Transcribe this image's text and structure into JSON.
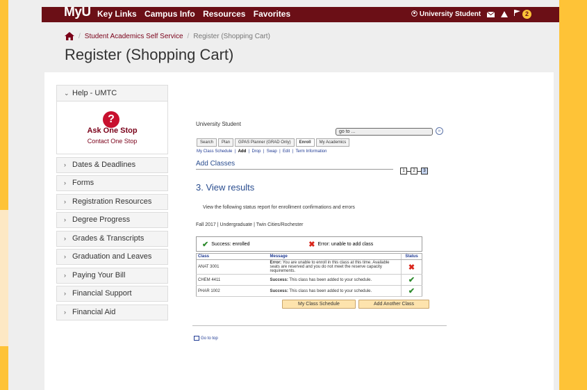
{
  "colors": {
    "accent_yellow": "#fec337",
    "maroon": "#6b0f16",
    "link_blue": "#2a4d8f",
    "success_green": "#2e8b2e",
    "error_red": "#d9261c"
  },
  "topbar": {
    "logo": "MyU",
    "links": [
      "Key Links",
      "Campus Info",
      "Resources",
      "Favorites"
    ],
    "user": "University Student",
    "notifications_count": "2"
  },
  "breadcrumb": {
    "home_icon": "home-icon",
    "items": [
      "Student Academics Self Service",
      "Register (Shopping Cart)"
    ]
  },
  "page_title": "Register (Shopping Cart)",
  "sidebar": {
    "help": "Help - UMTC",
    "ask_one_stop": "Ask One Stop",
    "contact": "Contact One Stop",
    "items": [
      "Dates & Deadlines",
      "Forms",
      "Registration Resources",
      "Degree Progress",
      "Grades & Transcripts",
      "Graduation and Leaves",
      "Paying Your Bill",
      "Financial Support",
      "Financial Aid"
    ]
  },
  "main": {
    "user_name": "University Student",
    "goto_placeholder": "go to ...",
    "tabs": [
      "Search",
      "Plan",
      "GPAS Planner (GRAD Only)",
      "Enroll",
      "My Academics"
    ],
    "subnav": [
      "My Class Schedule",
      "Add",
      "Drop",
      "Swap",
      "Edit",
      "Term Information"
    ],
    "section": "Add Classes",
    "steps": [
      "1",
      "2",
      "3"
    ],
    "heading": "3.  View results",
    "description": "View the following status report for enrollment confirmations and errors",
    "term": "Fall 2017 | Undergraduate | Twin Cities/Rochester",
    "legend_success": "Success: enrolled",
    "legend_error": "Error: unable to add class",
    "table_headers": [
      "Class",
      "Message",
      "Status"
    ],
    "rows": [
      {
        "class": "ANAT 3001",
        "label": "Error:",
        "message": "You are unable to enroll in this class at this time. Available seats are reserved and you do not meet the reserve capacity requirements.",
        "status": "error"
      },
      {
        "class": "CHEM 4411",
        "label": "Success:",
        "message": "This class has been added to your schedule.",
        "status": "success"
      },
      {
        "class": "PHAR 1002",
        "label": "Success:",
        "message": "This class has been added to your schedule.",
        "status": "success"
      }
    ],
    "btn_schedule": "My Class Schedule",
    "btn_another": "Add Another Class",
    "go_to_top": "Go to top"
  }
}
